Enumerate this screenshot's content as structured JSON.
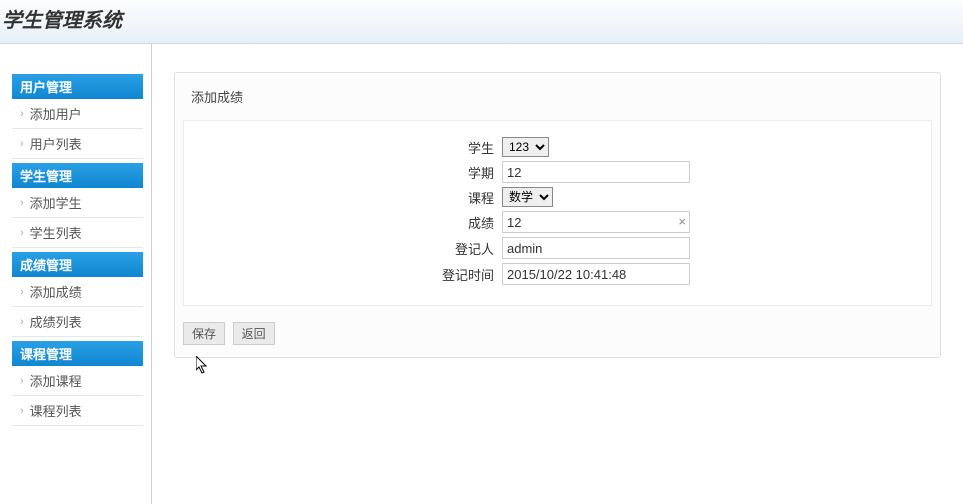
{
  "header": {
    "title": "学生管理系统"
  },
  "sidebar": {
    "sections": [
      {
        "title": "用户管理",
        "items": [
          "添加用户",
          "用户列表"
        ]
      },
      {
        "title": "学生管理",
        "items": [
          "添加学生",
          "学生列表"
        ]
      },
      {
        "title": "成绩管理",
        "items": [
          "添加成绩",
          "成绩列表"
        ]
      },
      {
        "title": "课程管理",
        "items": [
          "添加课程",
          "课程列表"
        ]
      }
    ]
  },
  "panel": {
    "title": "添加成绩"
  },
  "form": {
    "student_label": "学生",
    "student_value": "123",
    "semester_label": "学期",
    "semester_value": "12",
    "course_label": "课程",
    "course_value": "数学",
    "score_label": "成绩",
    "score_value": "12",
    "registrant_label": "登记人",
    "registrant_value": "admin",
    "regtime_label": "登记时间",
    "regtime_value": "2015/10/22 10:41:48"
  },
  "buttons": {
    "save": "保存",
    "back": "返回"
  }
}
